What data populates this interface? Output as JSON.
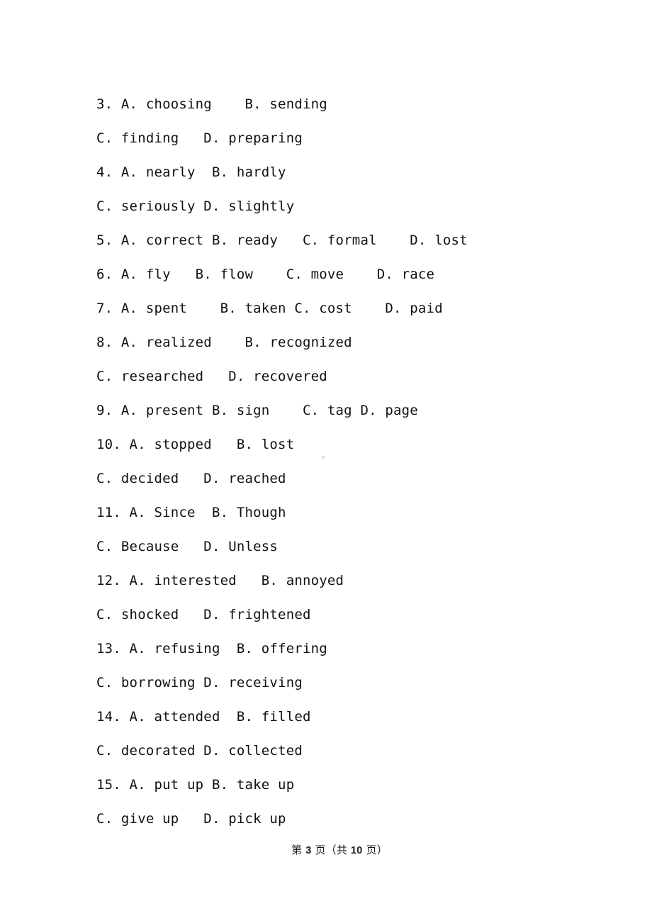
{
  "document": {
    "type": "exam-paper",
    "language": "en-with-zh-footer",
    "background_color": "#ffffff",
    "text_color": "#111111"
  },
  "options_block": {
    "lines": [
      {
        "id": "q3-ab",
        "number": "3.",
        "text": "3. A. choosing    B. sending"
      },
      {
        "id": "q3-cd",
        "number": "",
        "text": "C. finding   D. preparing"
      },
      {
        "id": "q4-ab",
        "number": "4.",
        "text": "4. A. nearly  B. hardly"
      },
      {
        "id": "q4-cd",
        "number": "",
        "text": "C. seriously D. slightly"
      },
      {
        "id": "q5-abcd",
        "number": "5.",
        "text": "5. A. correct B. ready   C. formal    D. lost"
      },
      {
        "id": "q6-abcd",
        "number": "6.",
        "text": "6. A. fly   B. flow    C. move    D. race"
      },
      {
        "id": "q7-abcd",
        "number": "7.",
        "text": "7. A. spent    B. taken C. cost    D. paid"
      },
      {
        "id": "q8-ab",
        "number": "8.",
        "text": "8. A. realized    B. recognized"
      },
      {
        "id": "q8-cd",
        "number": "",
        "text": "C. researched   D. recovered"
      },
      {
        "id": "q9-abcd",
        "number": "9.",
        "text": "9. A. present B. sign    C. tag D. page"
      },
      {
        "id": "q10-ab",
        "number": "10.",
        "text": "10. A. stopped   B. lost"
      },
      {
        "id": "q10-cd",
        "number": "",
        "text": "C. decided   D. reached"
      },
      {
        "id": "q11-ab",
        "number": "11.",
        "text": "11. A. Since  B. Though"
      },
      {
        "id": "q11-cd",
        "number": "",
        "text": "C. Because   D. Unless"
      },
      {
        "id": "q12-ab",
        "number": "12.",
        "text": "12. A. interested   B. annoyed"
      },
      {
        "id": "q12-cd",
        "number": "",
        "text": "C. shocked   D. frightened"
      },
      {
        "id": "q13-ab",
        "number": "13.",
        "text": "13. A. refusing  B. offering"
      },
      {
        "id": "q13-cd",
        "number": "",
        "text": "C. borrowing D. receiving"
      },
      {
        "id": "q14-ab",
        "number": "14.",
        "text": "14. A. attended  B. filled"
      },
      {
        "id": "q14-cd",
        "number": "",
        "text": "C. decorated D. collected"
      },
      {
        "id": "q15-ab",
        "number": "15.",
        "text": "15. A. put up B. take up"
      },
      {
        "id": "q15-cd",
        "number": "",
        "text": "C. give up   D. pick up"
      }
    ]
  },
  "questions": [
    {
      "number": "3",
      "choices": [
        {
          "letter": "A.",
          "word": "choosing"
        },
        {
          "letter": "B.",
          "word": "sending"
        },
        {
          "letter": "C.",
          "word": "finding"
        },
        {
          "letter": "D.",
          "word": "preparing"
        }
      ]
    },
    {
      "number": "4",
      "choices": [
        {
          "letter": "A.",
          "word": "nearly"
        },
        {
          "letter": "B.",
          "word": "hardly"
        },
        {
          "letter": "C.",
          "word": "seriously"
        },
        {
          "letter": "D.",
          "word": "slightly"
        }
      ]
    },
    {
      "number": "5",
      "choices": [
        {
          "letter": "A.",
          "word": "correct"
        },
        {
          "letter": "B.",
          "word": "ready"
        },
        {
          "letter": "C.",
          "word": "formal"
        },
        {
          "letter": "D.",
          "word": "lost"
        }
      ]
    },
    {
      "number": "6",
      "choices": [
        {
          "letter": "A.",
          "word": "fly"
        },
        {
          "letter": "B.",
          "word": "flow"
        },
        {
          "letter": "C.",
          "word": "move"
        },
        {
          "letter": "D.",
          "word": "race"
        }
      ]
    },
    {
      "number": "7",
      "choices": [
        {
          "letter": "A.",
          "word": "spent"
        },
        {
          "letter": "B.",
          "word": "taken"
        },
        {
          "letter": "C.",
          "word": "cost"
        },
        {
          "letter": "D.",
          "word": "paid"
        }
      ]
    },
    {
      "number": "8",
      "choices": [
        {
          "letter": "A.",
          "word": "realized"
        },
        {
          "letter": "B.",
          "word": "recognized"
        },
        {
          "letter": "C.",
          "word": "researched"
        },
        {
          "letter": "D.",
          "word": "recovered"
        }
      ]
    },
    {
      "number": "9",
      "choices": [
        {
          "letter": "A.",
          "word": "present"
        },
        {
          "letter": "B.",
          "word": "sign"
        },
        {
          "letter": "C.",
          "word": "tag"
        },
        {
          "letter": "D.",
          "word": "page"
        }
      ]
    },
    {
      "number": "10",
      "choices": [
        {
          "letter": "A.",
          "word": "stopped"
        },
        {
          "letter": "B.",
          "word": "lost"
        },
        {
          "letter": "C.",
          "word": "decided"
        },
        {
          "letter": "D.",
          "word": "reached"
        }
      ]
    },
    {
      "number": "11",
      "choices": [
        {
          "letter": "A.",
          "word": "Since"
        },
        {
          "letter": "B.",
          "word": "Though"
        },
        {
          "letter": "C.",
          "word": "Because"
        },
        {
          "letter": "D.",
          "word": "Unless"
        }
      ]
    },
    {
      "number": "12",
      "choices": [
        {
          "letter": "A.",
          "word": "interested"
        },
        {
          "letter": "B.",
          "word": "annoyed"
        },
        {
          "letter": "C.",
          "word": "shocked"
        },
        {
          "letter": "D.",
          "word": "frightened"
        }
      ]
    },
    {
      "number": "13",
      "choices": [
        {
          "letter": "A.",
          "word": "refusing"
        },
        {
          "letter": "B.",
          "word": "offering"
        },
        {
          "letter": "C.",
          "word": "borrowing"
        },
        {
          "letter": "D.",
          "word": "receiving"
        }
      ]
    },
    {
      "number": "14",
      "choices": [
        {
          "letter": "A.",
          "word": "attended"
        },
        {
          "letter": "B.",
          "word": "filled"
        },
        {
          "letter": "C.",
          "word": "decorated"
        },
        {
          "letter": "D.",
          "word": "collected"
        }
      ]
    },
    {
      "number": "15",
      "choices": [
        {
          "letter": "A.",
          "word": "put up"
        },
        {
          "letter": "B.",
          "word": "take up"
        },
        {
          "letter": "C.",
          "word": "give up"
        },
        {
          "letter": "D.",
          "word": "pick up"
        }
      ]
    }
  ],
  "footer": {
    "prefix": "第 ",
    "current_page": "3",
    "middle": " 页（共 ",
    "total_pages": "10",
    "suffix": " 页）",
    "full_text": "第 3 页（共 10 页）"
  },
  "artifact": {
    "description": "faint gray square scanning speck",
    "color": "#e6e6e6"
  }
}
